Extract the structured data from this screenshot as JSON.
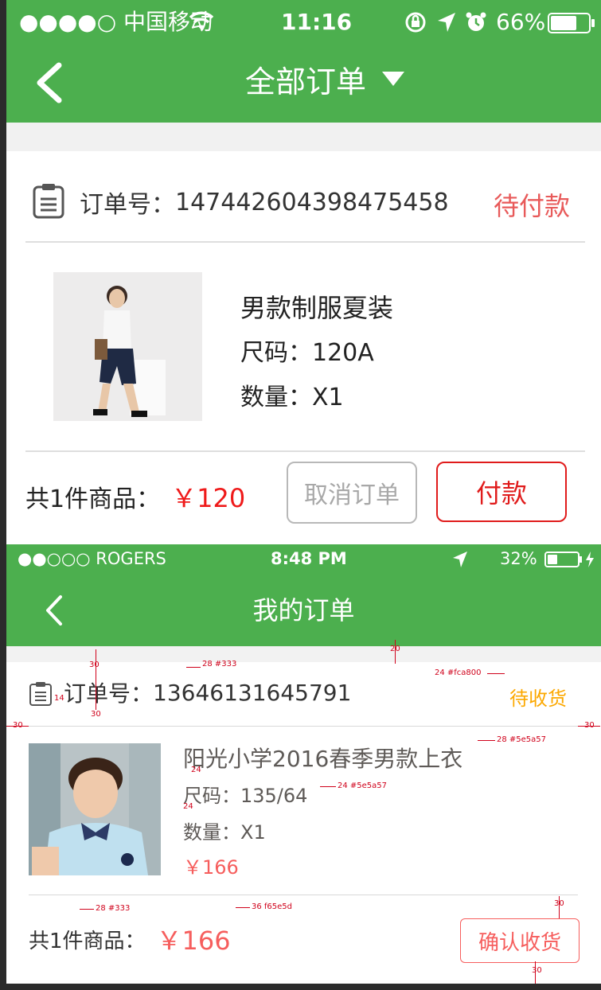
{
  "screen1": {
    "status_bar": {
      "carrier": "●●●●○ 中国移动",
      "time": "11:16",
      "battery": "66%"
    },
    "nav": {
      "title": "全部订单"
    },
    "order": {
      "order_label": "订单号：",
      "order_number": "147442604398475458",
      "status": "待付款",
      "product": {
        "name": "男款制服夏装",
        "size": "尺码：120A",
        "quantity": "数量：X1"
      },
      "summary_label": "共1件商品：",
      "total": "￥120",
      "cancel_button": "取消订单",
      "pay_button": "付款"
    },
    "colors": {
      "header": "#4caf4e",
      "status": "#e85a5a",
      "price": "#ef1a1a"
    }
  },
  "screen2": {
    "status_bar": {
      "carrier": "●●○○○ ROGERS",
      "time": "8:48 PM",
      "battery": "32%"
    },
    "nav": {
      "title": "我的订单"
    },
    "order": {
      "order_label": "订单号：",
      "order_number": "13646131645791",
      "status": "待收货",
      "product": {
        "name": "阳光小学2016春季男款上衣",
        "size": "尺码：135/64",
        "quantity": "数量：X1",
        "price": "￥166"
      },
      "summary_label": "共1件商品：",
      "total": "￥166",
      "confirm_button": "确认收货"
    },
    "colors": {
      "status": "#fca800",
      "text": "#5e5a57",
      "price": "#f65e5d"
    },
    "annotations": {
      "a_gap20": "20",
      "a_30top": "30",
      "a_28_333": "28 #333",
      "a_24_fca800": "24 #fca800",
      "a_14": "14",
      "a_30bottom": "30",
      "a_30left": "30",
      "a_30right": "30",
      "a_28_5e5a57": "28 #5e5a57",
      "a_24a": "24",
      "a_24_5e5a57": "24 #5e5a57",
      "a_24b": "24",
      "a_28_333b": "28 #333",
      "a_36_f65e5d": "36 f65e5d",
      "a_30c": "30",
      "a_30d": "30"
    }
  }
}
